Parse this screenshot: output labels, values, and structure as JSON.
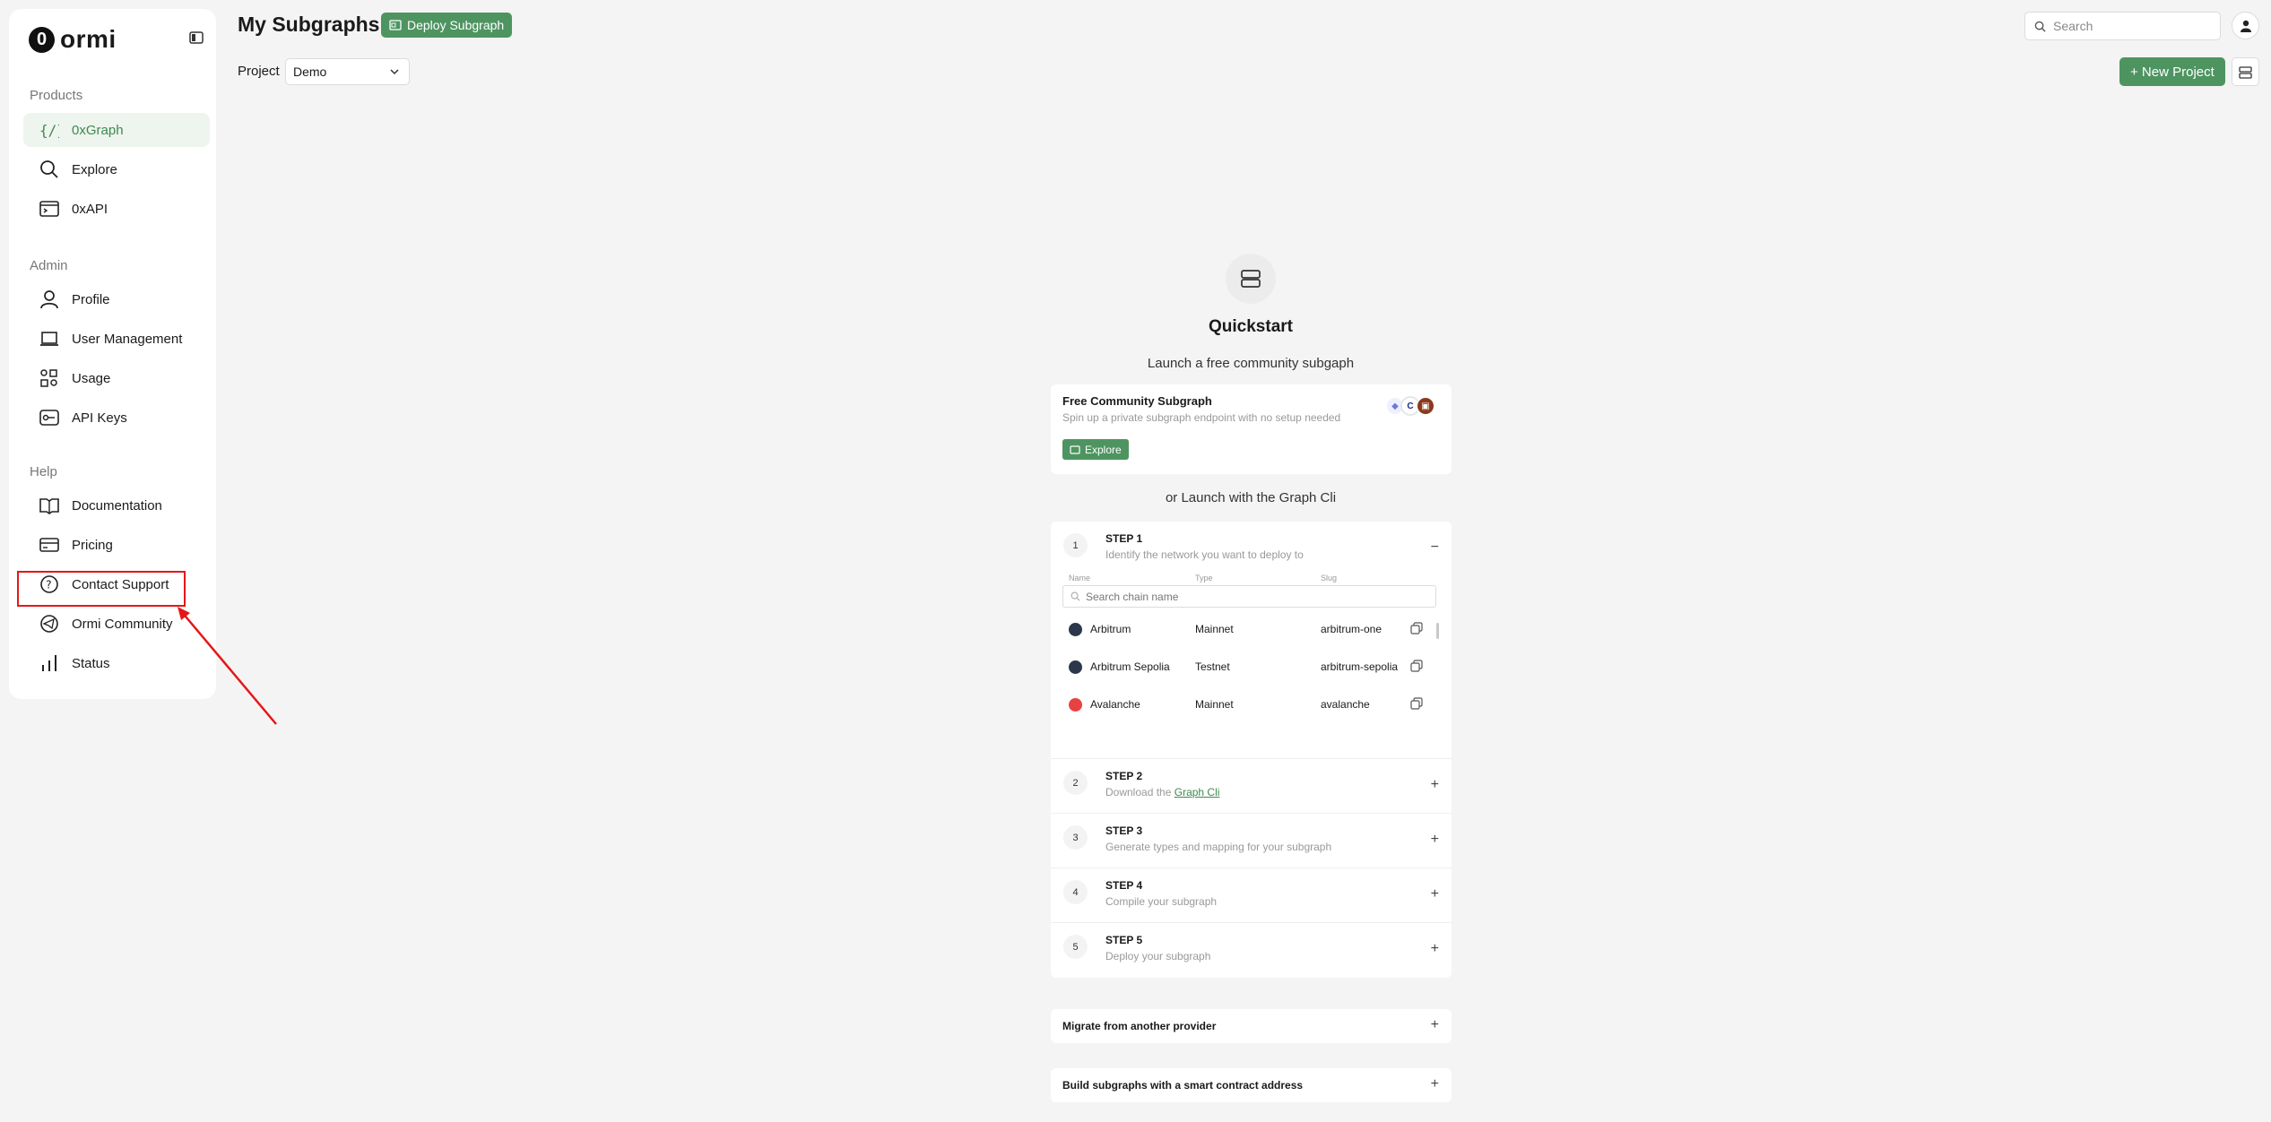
{
  "brand": {
    "name": "ormi",
    "mark": "0"
  },
  "sidebar": {
    "sections": [
      {
        "label": "Products"
      },
      {
        "label": "Admin"
      },
      {
        "label": "Help"
      }
    ],
    "items": [
      {
        "label": "0xGraph"
      },
      {
        "label": "Explore"
      },
      {
        "label": "0xAPI"
      },
      {
        "label": "Profile"
      },
      {
        "label": "User Management"
      },
      {
        "label": "Usage"
      },
      {
        "label": "API Keys"
      },
      {
        "label": "Documentation"
      },
      {
        "label": "Pricing"
      },
      {
        "label": "Contact Support"
      },
      {
        "label": "Ormi Community"
      },
      {
        "label": "Status"
      }
    ]
  },
  "header": {
    "title": "My Subgraphs",
    "deploy_label": "Deploy Subgraph",
    "project_label": "Project",
    "project_value": "Demo",
    "search_placeholder": "Search",
    "new_project_label": "+ New Project"
  },
  "quickstart": {
    "title": "Quickstart",
    "subtitle": "Launch a free community subgaph",
    "free_card": {
      "title": "Free Community Subgraph",
      "subtitle": "Spin up a private subgraph endpoint with no setup needed",
      "explore_label": "Explore"
    },
    "or_launch": "or Launch with the Graph Cli",
    "step1": {
      "num": "1",
      "title": "STEP 1",
      "desc": "Identify the network you want to deploy to",
      "columns": [
        "Name",
        "Type",
        "Slug"
      ],
      "search_placeholder": "Search chain name",
      "chains": [
        {
          "name": "Arbitrum",
          "type": "Mainnet",
          "slug": "arbitrum-one",
          "color": "#2d374b"
        },
        {
          "name": "Arbitrum Sepolia",
          "type": "Testnet",
          "slug": "arbitrum-sepolia",
          "color": "#2d374b"
        },
        {
          "name": "Avalanche",
          "type": "Mainnet",
          "slug": "avalanche",
          "color": "#e84142"
        }
      ]
    },
    "step2": {
      "num": "2",
      "title": "STEP 2",
      "desc_prefix": "Download the",
      "desc_link": "Graph Cli"
    },
    "step3": {
      "num": "3",
      "title": "STEP 3",
      "desc": "Generate types and mapping for your subgraph"
    },
    "step4": {
      "num": "4",
      "title": "STEP 4",
      "desc": "Compile your subgraph"
    },
    "step5": {
      "num": "5",
      "title": "STEP 5",
      "desc": "Deploy your subgraph"
    },
    "migrate": "Migrate from another provider",
    "build_contract": "Build subgraphs with a smart contract address"
  },
  "colors": {
    "accent": "#4e9461",
    "highlight": "#e41818"
  }
}
